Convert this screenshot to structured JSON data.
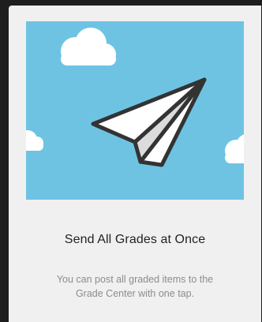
{
  "card": {
    "title": "Send All Grades at Once",
    "description_line1": "You can post all graded items to the",
    "description_line2": "Grade Center with one tap."
  },
  "illustration": {
    "icon": "paper-plane-icon",
    "decorations": [
      "cloud-icon",
      "cloud-icon",
      "cloud-icon"
    ]
  },
  "colors": {
    "sky": "#6ec3e3",
    "card_background": "#f0f0f0",
    "outline": "#333333",
    "title_text": "#222222",
    "description_text": "#8c8c8c"
  }
}
